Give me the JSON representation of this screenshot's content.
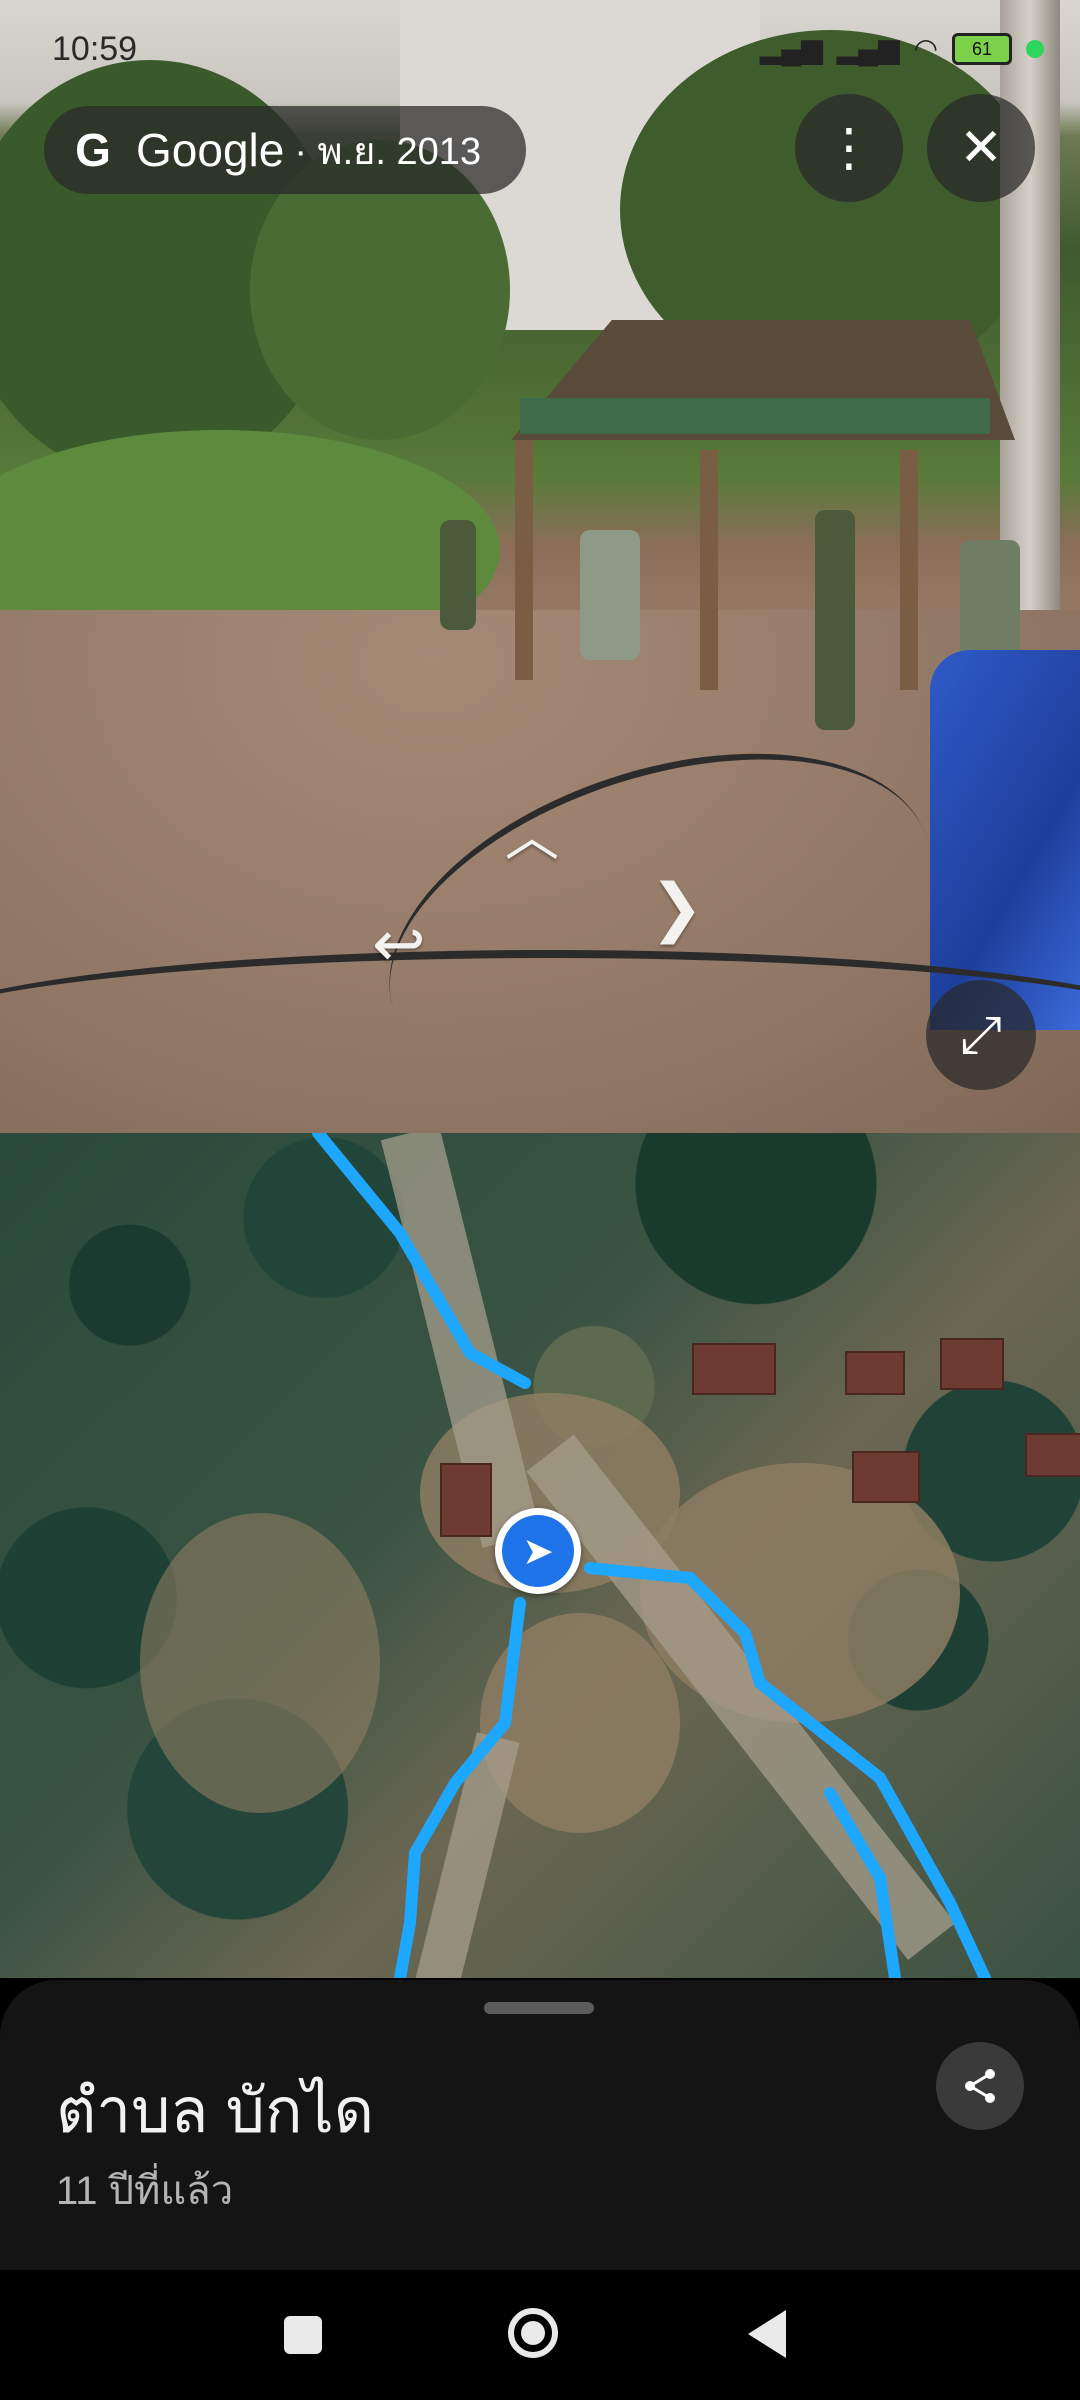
{
  "status_bar": {
    "time": "10:59",
    "battery": "61",
    "icons": [
      "signal-icon",
      "signal-icon",
      "wifi-icon",
      "battery-icon",
      "privacy-dot-icon"
    ]
  },
  "street_view": {
    "brand": "Google",
    "capture_date": "· พ.ย. 2013",
    "logo_icon": "google-g-icon",
    "more_icon": "more-vert-icon",
    "close_icon": "close-icon",
    "expand_icon": "fullscreen-icon",
    "nav_arrows": [
      "forward-arrow-icon",
      "right-arrow-icon",
      "back-left-arrow-icon"
    ]
  },
  "map": {
    "route_color": "#1ea7ff",
    "location_color": "#1f73e8",
    "location_icon": "navigation-arrow-icon"
  },
  "place": {
    "title": "ตำบล บักได",
    "subtitle": "11 ปีที่แล้ว",
    "share_icon": "share-icon"
  },
  "nav_bar": {
    "buttons": [
      "recents-button",
      "home-button",
      "back-button"
    ]
  }
}
